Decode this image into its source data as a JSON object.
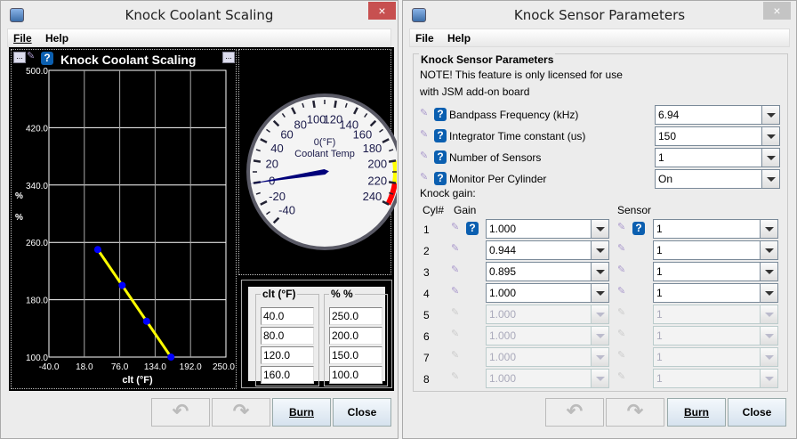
{
  "left": {
    "title": "Knock Coolant Scaling",
    "close_icon": "×",
    "menu": {
      "file": "File",
      "help": "Help"
    },
    "panel_title": "Knock Coolant Scaling",
    "more_label": "...",
    "help_label": "?",
    "table": {
      "col1_header": "clt (°F)",
      "col2_header": "% %",
      "col1": [
        "40.0",
        "80.0",
        "120.0",
        "160.0"
      ],
      "col2": [
        "250.0",
        "200.0",
        "150.0",
        "100.0"
      ]
    },
    "gauge": {
      "value_label": "0(°F)",
      "title": "Coolant Temp",
      "min": -40,
      "max": 240,
      "value": 0,
      "labels": [
        "-40",
        "-20",
        "0",
        "20",
        "40",
        "60",
        "80",
        "100",
        "120",
        "140",
        "160",
        "180",
        "200",
        "220",
        "240"
      ],
      "warn_start": 200,
      "danger_start": 220,
      "colors": {
        "warn": "#ffff00",
        "danger": "#ff0000",
        "needle": "#00007a"
      }
    },
    "buttons": {
      "undo": "↶",
      "redo": "↷",
      "burn": "Burn",
      "close": "Close"
    }
  },
  "chart_data": {
    "type": "line",
    "title": "Knock Coolant Scaling",
    "xlabel": "clt (°F)",
    "ylabel": [
      "%",
      "%"
    ],
    "x": [
      40,
      80,
      120,
      160
    ],
    "values": [
      250,
      200,
      150,
      100
    ],
    "xlim": [
      -40,
      250
    ],
    "ylim": [
      100,
      500
    ],
    "xticks": [
      "-40.0",
      "18.0",
      "76.0",
      "134.0",
      "192.0",
      "250.0"
    ],
    "yticks": [
      "100.0",
      "180.0",
      "260.0",
      "340.0",
      "420.0",
      "500.0"
    ],
    "grid": true,
    "colors": {
      "line": "#ffff00",
      "point": "#0000ff"
    }
  },
  "right": {
    "title": "Knock Sensor Parameters",
    "close_icon": "×",
    "menu": {
      "file": "File",
      "help": "Help"
    },
    "group_title": "Knock Sensor Parameters",
    "note": [
      "NOTE! This feature is only licensed for use",
      "with JSM add-on board"
    ],
    "params": [
      {
        "label": "Bandpass Frequency (kHz)",
        "value": "6.94"
      },
      {
        "label": "Integrator Time constant (us)",
        "value": "150"
      },
      {
        "label": "Number of Sensors",
        "value": "1"
      },
      {
        "label": "Monitor Per Cylinder",
        "value": "On"
      }
    ],
    "knock_gain_label": "Knock gain:",
    "headers": {
      "cyl": "Cyl#",
      "gain": "Gain",
      "sensor": "Sensor"
    },
    "help_label": "?",
    "cylinders": [
      {
        "cyl": "1",
        "gain": "1.000",
        "sensor": "1",
        "enabled": true
      },
      {
        "cyl": "2",
        "gain": "0.944",
        "sensor": "1",
        "enabled": true
      },
      {
        "cyl": "3",
        "gain": "0.895",
        "sensor": "1",
        "enabled": true
      },
      {
        "cyl": "4",
        "gain": "1.000",
        "sensor": "1",
        "enabled": true
      },
      {
        "cyl": "5",
        "gain": "1.000",
        "sensor": "1",
        "enabled": false
      },
      {
        "cyl": "6",
        "gain": "1.000",
        "sensor": "1",
        "enabled": false
      },
      {
        "cyl": "7",
        "gain": "1.000",
        "sensor": "1",
        "enabled": false
      },
      {
        "cyl": "8",
        "gain": "1.000",
        "sensor": "1",
        "enabled": false
      }
    ],
    "buttons": {
      "undo": "↶",
      "redo": "↷",
      "burn": "Burn",
      "close": "Close"
    }
  }
}
